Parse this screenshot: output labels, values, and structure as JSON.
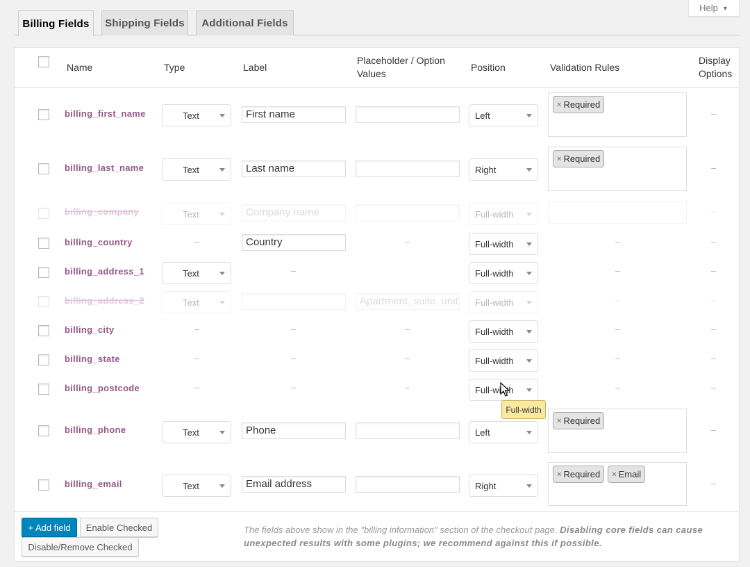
{
  "help": {
    "label": "Help"
  },
  "tabs": [
    {
      "label": "Billing Fields",
      "active": true
    },
    {
      "label": "Shipping Fields",
      "active": false
    },
    {
      "label": "Additional Fields",
      "active": false
    }
  ],
  "table": {
    "columns": {
      "name": "Name",
      "type": "Type",
      "label": "Label",
      "placeholder_line1": "Placeholder / Option",
      "placeholder_line2": "Values",
      "position": "Position",
      "validation": "Validation Rules",
      "display_line1": "Display",
      "display_line2": "Options"
    },
    "rows": [
      {
        "name": "billing_first_name",
        "type": "Text",
        "label": "First name",
        "placeholder": "",
        "position": "Left",
        "validation": [
          "Required"
        ],
        "display": "–",
        "disabled": false
      },
      {
        "name": "billing_last_name",
        "type": "Text",
        "label": "Last name",
        "placeholder": "",
        "position": "Right",
        "validation": [
          "Required"
        ],
        "display": "–",
        "disabled": false
      },
      {
        "name": "billing_company",
        "type": "Text",
        "label_placeholder": "Company name",
        "placeholder": "",
        "position": "Full-width",
        "validation": [],
        "display": "–",
        "disabled": true
      },
      {
        "name": "billing_country",
        "type": "–",
        "label": "Country",
        "placeholder": "–",
        "position": "Full-width",
        "validation": "–",
        "display": "–",
        "disabled": false
      },
      {
        "name": "billing_address_1",
        "type": "Text",
        "label": "–",
        "placeholder": "",
        "position": "Full-width",
        "validation": "–",
        "display": "–",
        "disabled": false
      },
      {
        "name": "billing_address_2",
        "type": "Text",
        "label": "",
        "placeholder": "Apartment, suite, unit etc.",
        "position": "Full-width",
        "validation": "–",
        "display": "–",
        "disabled": true
      },
      {
        "name": "billing_city",
        "type": "–",
        "label": "–",
        "placeholder": "–",
        "position": "Full-width",
        "validation": "–",
        "display": "–",
        "disabled": false
      },
      {
        "name": "billing_state",
        "type": "–",
        "label": "–",
        "placeholder": "–",
        "position": "Full-width",
        "validation": "–",
        "display": "–",
        "disabled": false
      },
      {
        "name": "billing_postcode",
        "type": "–",
        "label": "–",
        "placeholder": "–",
        "position": "Full-width",
        "validation": "–",
        "display": "–",
        "disabled": false
      },
      {
        "name": "billing_phone",
        "type": "Text",
        "label": "Phone",
        "placeholder": "",
        "position": "Left",
        "validation": [
          "Required"
        ],
        "display": "–",
        "disabled": false
      },
      {
        "name": "billing_email",
        "type": "Text",
        "label": "Email address",
        "placeholder": "",
        "position": "Right",
        "validation": [
          "Required",
          "Email"
        ],
        "display": "–",
        "disabled": false
      }
    ]
  },
  "tooltip": {
    "text": "Full-width"
  },
  "footer": {
    "add_field": "+ Add field",
    "enable_checked": "Enable Checked",
    "disable_checked": "Disable/Remove Checked",
    "note_plain": "The fields above show in the \"billing information\" section of the checkout page. ",
    "note_bold": "Disabling core fields can cause unexpected results with some plugins; we recommend against this if possible."
  },
  "colors": {
    "field_name": "#96588a",
    "primary_button": "#0085ba",
    "tooltip_bg": "#fbe8a0"
  }
}
